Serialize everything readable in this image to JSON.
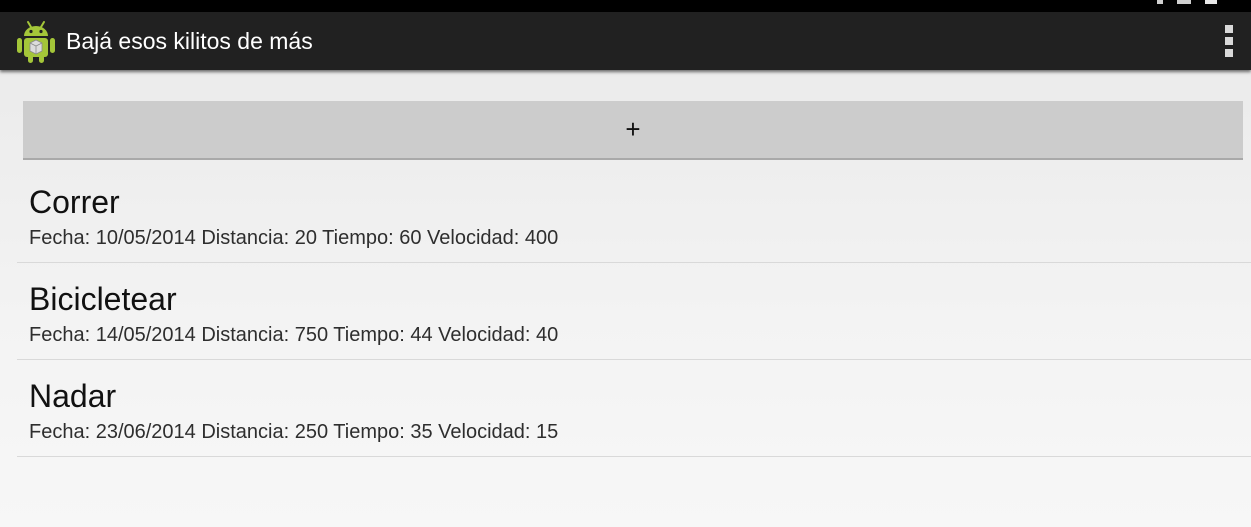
{
  "status_bar": {
    "icons": [
      "signal-icon",
      "notification-icon",
      "battery-icon"
    ]
  },
  "action_bar": {
    "title": "Bajá esos kilitos de más",
    "app_icon": "android-robot-icon",
    "overflow_icon": "overflow-menu-icon"
  },
  "add_button": {
    "label": "+"
  },
  "activities": [
    {
      "name": "Correr",
      "details": "Fecha: 10/05/2014 Distancia: 20 Tiempo: 60 Velocidad: 400"
    },
    {
      "name": "Bicicletear",
      "details": "Fecha: 14/05/2014 Distancia: 750 Tiempo: 44 Velocidad: 40"
    },
    {
      "name": "Nadar",
      "details": "Fecha: 23/06/2014 Distancia: 250 Tiempo: 35 Velocidad: 15"
    }
  ],
  "colors": {
    "action_bar_bg": "#212121",
    "button_bg": "#cccccc",
    "android_green": "#a4c639"
  }
}
